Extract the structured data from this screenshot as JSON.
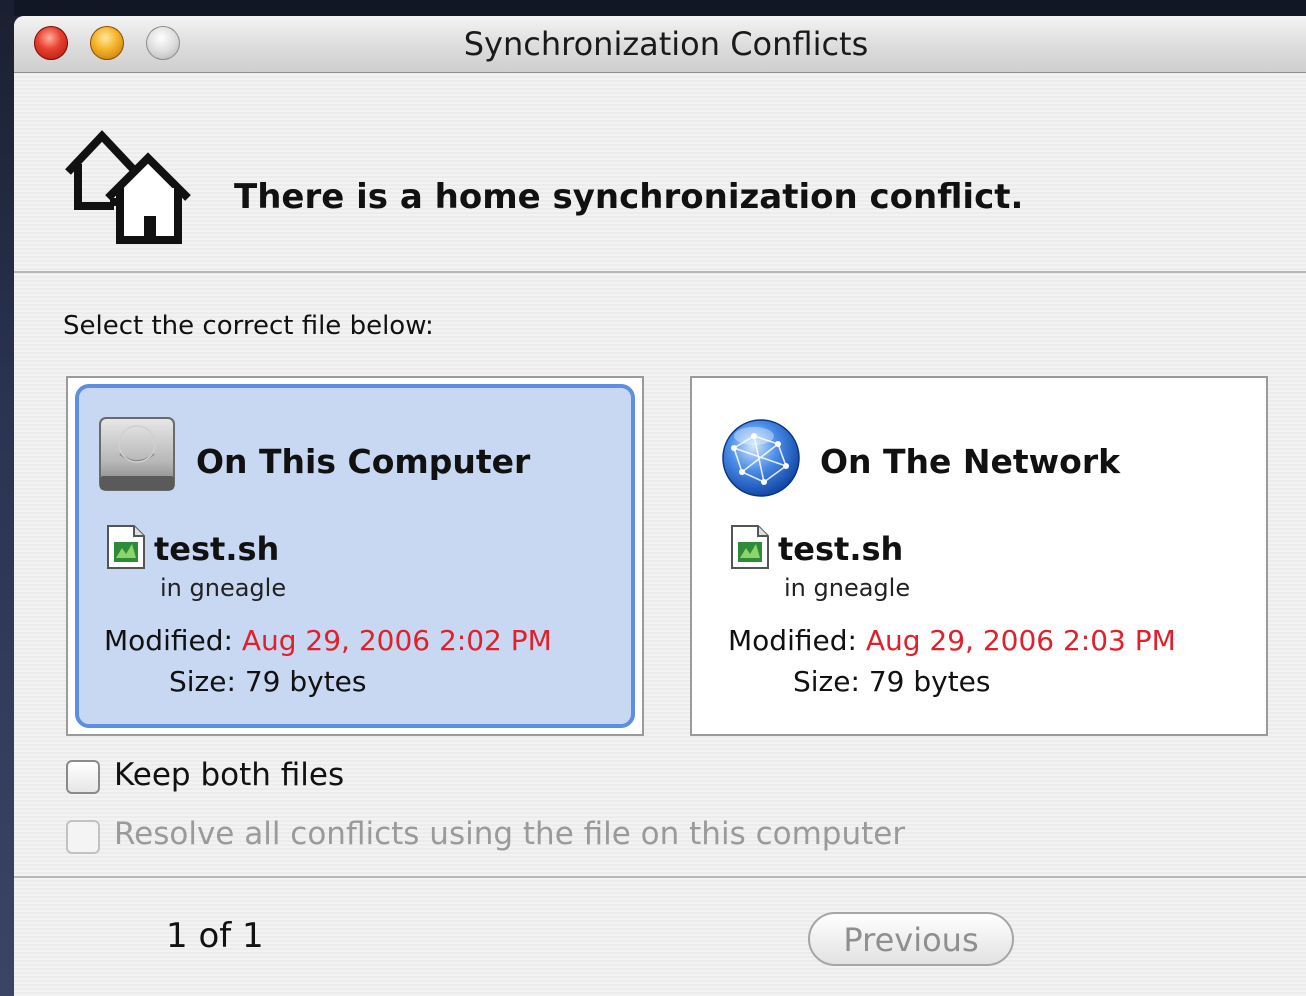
{
  "window": {
    "title": "Synchronization Conflicts"
  },
  "header": {
    "message": "There is a home synchronization conflict."
  },
  "instructions": "Select the correct file below:",
  "options": [
    {
      "title": "On This Computer",
      "icon": "hard-drive-icon",
      "selected": true,
      "file_name": "test.sh",
      "location": "in gneagle",
      "modified_label": "Modified:",
      "modified_value": "Aug 29, 2006 2:02 PM",
      "size_label": "Size:",
      "size_value": "79 bytes"
    },
    {
      "title": "On The Network",
      "icon": "network-globe-icon",
      "selected": false,
      "file_name": "test.sh",
      "location": "in gneagle",
      "modified_label": "Modified:",
      "modified_value": "Aug 29, 2006 2:03 PM",
      "size_label": "Size:",
      "size_value": "79 bytes"
    }
  ],
  "checkboxes": {
    "keep_both": {
      "label": "Keep both files",
      "checked": false,
      "enabled": true
    },
    "resolve_all": {
      "label": "Resolve all conflicts using the file on this computer",
      "checked": false,
      "enabled": false
    }
  },
  "footer": {
    "page_indicator": "1 of 1",
    "previous_label": "Previous"
  },
  "colors": {
    "selection_fill": "#c9d8f2",
    "selection_border": "#5d8ee2",
    "date_red": "#e0202a"
  }
}
